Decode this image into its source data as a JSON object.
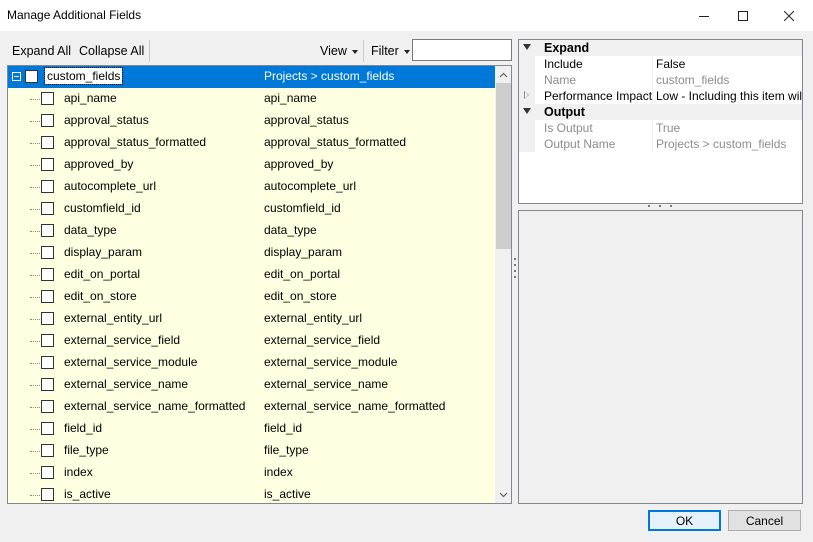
{
  "window": {
    "title": "Manage Additional Fields"
  },
  "toolbar": {
    "expand_all": "Expand All",
    "collapse_all": "Collapse All",
    "view": "View",
    "filter": "Filter",
    "filter_value": ""
  },
  "tree": {
    "root": {
      "name": "custom_fields",
      "path": "Projects > custom_fields",
      "checked": false,
      "selected": true,
      "expanded": true
    },
    "items": [
      {
        "name": "api_name",
        "path": "api_name"
      },
      {
        "name": "approval_status",
        "path": "approval_status"
      },
      {
        "name": "approval_status_formatted",
        "path": "approval_status_formatted"
      },
      {
        "name": "approved_by",
        "path": "approved_by"
      },
      {
        "name": "autocomplete_url",
        "path": "autocomplete_url"
      },
      {
        "name": "customfield_id",
        "path": "customfield_id"
      },
      {
        "name": "data_type",
        "path": "data_type"
      },
      {
        "name": "display_param",
        "path": "display_param"
      },
      {
        "name": "edit_on_portal",
        "path": "edit_on_portal"
      },
      {
        "name": "edit_on_store",
        "path": "edit_on_store"
      },
      {
        "name": "external_entity_url",
        "path": "external_entity_url"
      },
      {
        "name": "external_service_field",
        "path": "external_service_field"
      },
      {
        "name": "external_service_module",
        "path": "external_service_module"
      },
      {
        "name": "external_service_name",
        "path": "external_service_name"
      },
      {
        "name": "external_service_name_formatted",
        "path": "external_service_name_formatted"
      },
      {
        "name": "field_id",
        "path": "field_id"
      },
      {
        "name": "file_type",
        "path": "file_type"
      },
      {
        "name": "index",
        "path": "index"
      },
      {
        "name": "is_active",
        "path": "is_active"
      }
    ]
  },
  "properties": {
    "categories": [
      {
        "name": "Expand",
        "rows": [
          {
            "name": "Include",
            "value": "False",
            "readonly": false,
            "expandable": false
          },
          {
            "name": "Name",
            "value": "custom_fields",
            "readonly": true,
            "expandable": false
          },
          {
            "name": "Performance Impact",
            "value": "Low - Including this item will ha",
            "readonly": false,
            "expandable": true
          }
        ]
      },
      {
        "name": "Output",
        "rows": [
          {
            "name": "Is Output",
            "value": "True",
            "readonly": true,
            "expandable": false
          },
          {
            "name": "Output Name",
            "value": "Projects > custom_fields",
            "readonly": true,
            "expandable": false
          }
        ]
      }
    ]
  },
  "buttons": {
    "ok": "OK",
    "cancel": "Cancel"
  },
  "colors": {
    "selection": "#0078d7",
    "row_background": "#ffffe1",
    "readonly_text": "#8c8c8c"
  }
}
